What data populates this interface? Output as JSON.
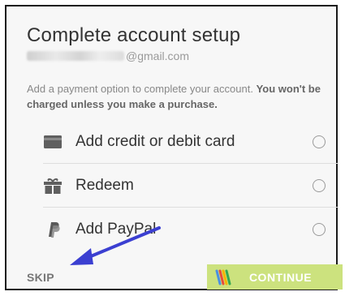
{
  "dialog": {
    "title": "Complete account setup",
    "email_domain": "@gmail.com",
    "description_plain": "Add a payment option to complete your account.",
    "description_bold": "You won't be charged unless you make a purchase."
  },
  "options": [
    {
      "label": "Add credit or debit card",
      "icon": "credit-card-icon"
    },
    {
      "label": "Redeem",
      "icon": "gift-icon"
    },
    {
      "label": "Add PayPal",
      "icon": "paypal-icon"
    }
  ],
  "footer": {
    "skip_label": "SKIP",
    "continue_label": "CONTINUE",
    "continue_icon": "google-wallet-icon"
  },
  "annotation": {
    "icon": "arrow-annotation",
    "color": "#3b3fd1"
  },
  "colors": {
    "continue_bg": "#cce27e",
    "text": "#333333",
    "muted": "#888888"
  }
}
